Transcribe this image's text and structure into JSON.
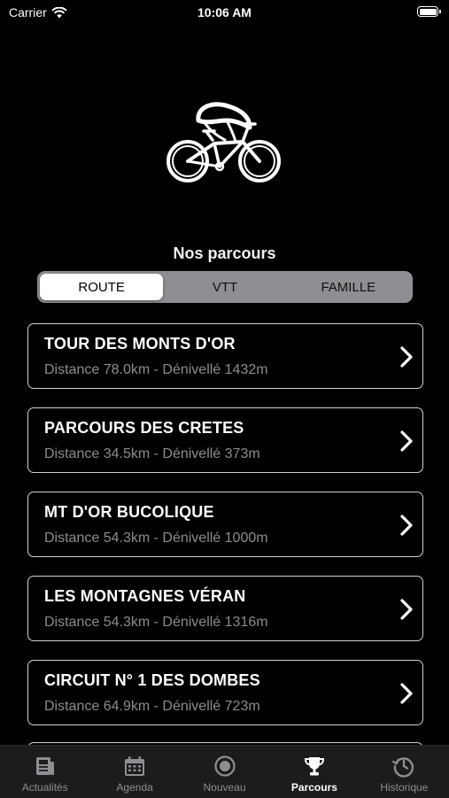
{
  "status_bar": {
    "carrier": "Carrier",
    "time": "10:06 AM"
  },
  "section_title": "Nos parcours",
  "segments": [
    {
      "label": "ROUTE",
      "selected": true
    },
    {
      "label": "VTT",
      "selected": false
    },
    {
      "label": "FAMILLE",
      "selected": false
    }
  ],
  "routes": [
    {
      "title": "TOUR DES MONTS D'OR",
      "subtitle": "Distance 78.0km - Dénivellé 1432m"
    },
    {
      "title": "PARCOURS DES CRETES",
      "subtitle": "Distance 34.5km - Dénivellé 373m"
    },
    {
      "title": "MT D'OR BUCOLIQUE",
      "subtitle": "Distance 54.3km - Dénivellé 1000m"
    },
    {
      "title": "LES MONTAGNES VÉRAN",
      "subtitle": "Distance 54.3km - Dénivellé 1316m"
    },
    {
      "title": "CIRCUIT N° 1 DES DOMBES",
      "subtitle": "Distance 64.9km - Dénivellé 723m"
    }
  ],
  "tabs": [
    {
      "label": "Actualités",
      "icon": "newspaper-icon",
      "selected": false
    },
    {
      "label": "Agenda",
      "icon": "calendar-icon",
      "selected": false
    },
    {
      "label": "Nouveau",
      "icon": "record-icon",
      "selected": false
    },
    {
      "label": "Parcours",
      "icon": "trophy-icon",
      "selected": true
    },
    {
      "label": "Historique",
      "icon": "history-icon",
      "selected": false
    }
  ]
}
